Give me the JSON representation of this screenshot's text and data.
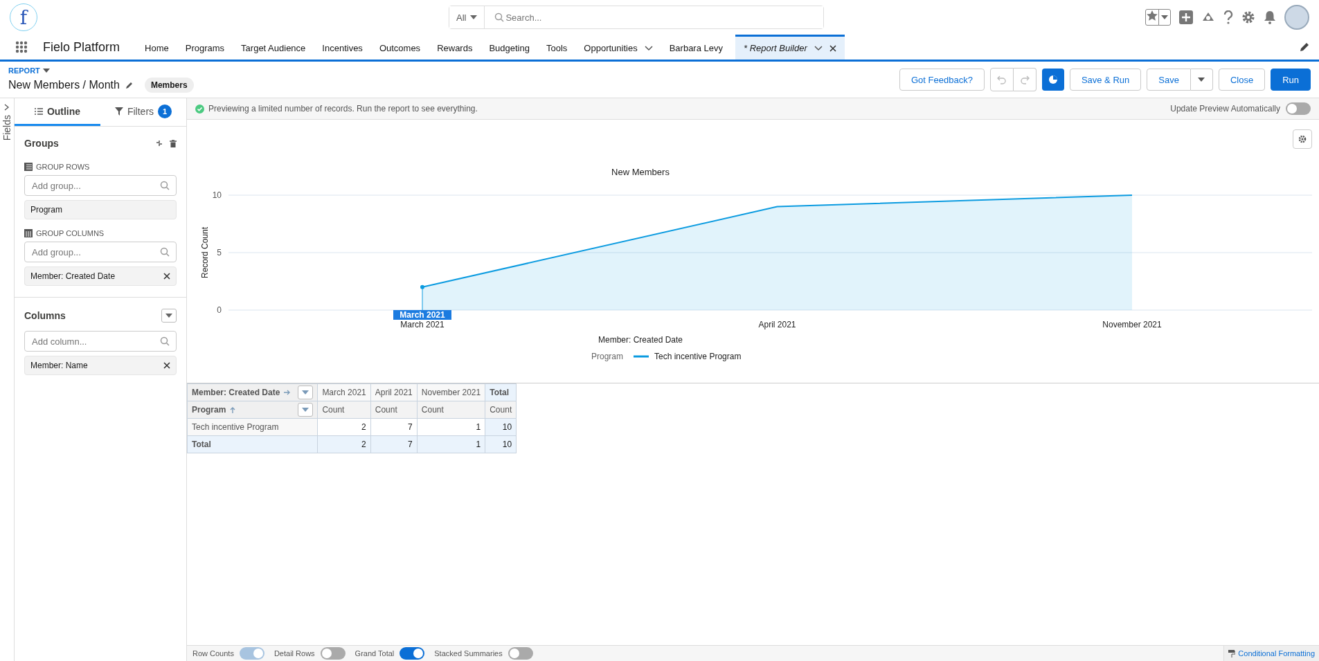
{
  "header": {
    "logo_text": "f",
    "search": {
      "scope": "All",
      "placeholder": "Search..."
    }
  },
  "nav": {
    "app_name": "Fielo Platform",
    "items": [
      {
        "label": "Home",
        "selected": false,
        "kind": "link"
      },
      {
        "label": "Programs",
        "selected": false,
        "kind": "link"
      },
      {
        "label": "Target Audience",
        "selected": false,
        "kind": "link"
      },
      {
        "label": "Incentives",
        "selected": false,
        "kind": "link"
      },
      {
        "label": "Outcomes",
        "selected": false,
        "kind": "link"
      },
      {
        "label": "Rewards",
        "selected": false,
        "kind": "link"
      },
      {
        "label": "Budgeting",
        "selected": false,
        "kind": "link"
      },
      {
        "label": "Tools",
        "selected": false,
        "kind": "link"
      },
      {
        "label": "Opportunities",
        "selected": false,
        "kind": "menu"
      },
      {
        "label": "Barbara Levy",
        "selected": false,
        "kind": "link"
      },
      {
        "label": "* Report Builder",
        "selected": true,
        "kind": "tab"
      }
    ]
  },
  "report": {
    "type_label": "REPORT",
    "title": "New Members / Month",
    "object_badge": "Members",
    "buttons": [
      {
        "label": "Got Feedback?",
        "kind": "outline"
      },
      {
        "label": "Save & Run",
        "kind": "outline"
      },
      {
        "label": "Save",
        "kind": "split"
      },
      {
        "label": "Close",
        "kind": "outline"
      },
      {
        "label": "Run",
        "kind": "brand"
      }
    ]
  },
  "sidebar": {
    "fields_label": "Fields",
    "tabs": [
      {
        "label": "Outline",
        "selected": true
      },
      {
        "label": "Filters",
        "selected": false,
        "badge": "1"
      }
    ],
    "groups": {
      "title": "Groups",
      "rows": {
        "label": "GROUP ROWS",
        "placeholder": "Add group...",
        "items": [
          {
            "label": "Program",
            "removable": false
          }
        ]
      },
      "columns": {
        "label": "GROUP COLUMNS",
        "placeholder": "Add group...",
        "items": [
          {
            "label": "Member: Created Date",
            "removable": true
          }
        ]
      }
    },
    "columns": {
      "title": "Columns",
      "placeholder": "Add column...",
      "items": [
        {
          "label": "Member: Name",
          "removable": true
        }
      ]
    }
  },
  "preview": {
    "message": "Previewing a limited number of records. Run the report to see everything.",
    "auto_update_label": "Update Preview Automatically",
    "auto_update_on": false
  },
  "chart": {
    "tooltip": "March 2021",
    "legend_title": "Program",
    "chart_data": {
      "type": "area",
      "title": "New Members",
      "xlabel": "Member: Created Date",
      "ylabel": "Record Count",
      "categories": [
        "March 2021",
        "April 2021",
        "November 2021"
      ],
      "series": [
        {
          "name": "Tech incentive Program",
          "color": "#0b9be0",
          "values": [
            2,
            9,
            10
          ]
        }
      ],
      "ylim": [
        0,
        10
      ],
      "yticks": [
        0,
        5,
        10
      ]
    }
  },
  "table": {
    "corner_column": "Member: Created Date",
    "corner_row": "Program",
    "columns": [
      {
        "label": "March 2021",
        "measure": "Count",
        "total": false
      },
      {
        "label": "April 2021",
        "measure": "Count",
        "total": false
      },
      {
        "label": "November 2021",
        "measure": "Count",
        "total": false
      },
      {
        "label": "Total",
        "measure": "Count",
        "total": true
      }
    ],
    "rows": [
      {
        "label": "Tech incentive Program",
        "total": false,
        "cells": [
          "2",
          "7",
          "1",
          "10"
        ]
      },
      {
        "label": "Total",
        "total": true,
        "cells": [
          "2",
          "7",
          "1",
          "10"
        ]
      }
    ]
  },
  "footer": {
    "toggles": [
      {
        "label": "Row Counts",
        "on": true,
        "disabled": true
      },
      {
        "label": "Detail Rows",
        "on": false,
        "disabled": false
      },
      {
        "label": "Grand Total",
        "on": true,
        "disabled": false
      },
      {
        "label": "Stacked Summaries",
        "on": false,
        "disabled": false
      }
    ],
    "conditional_formatting": "Conditional Formatting"
  }
}
